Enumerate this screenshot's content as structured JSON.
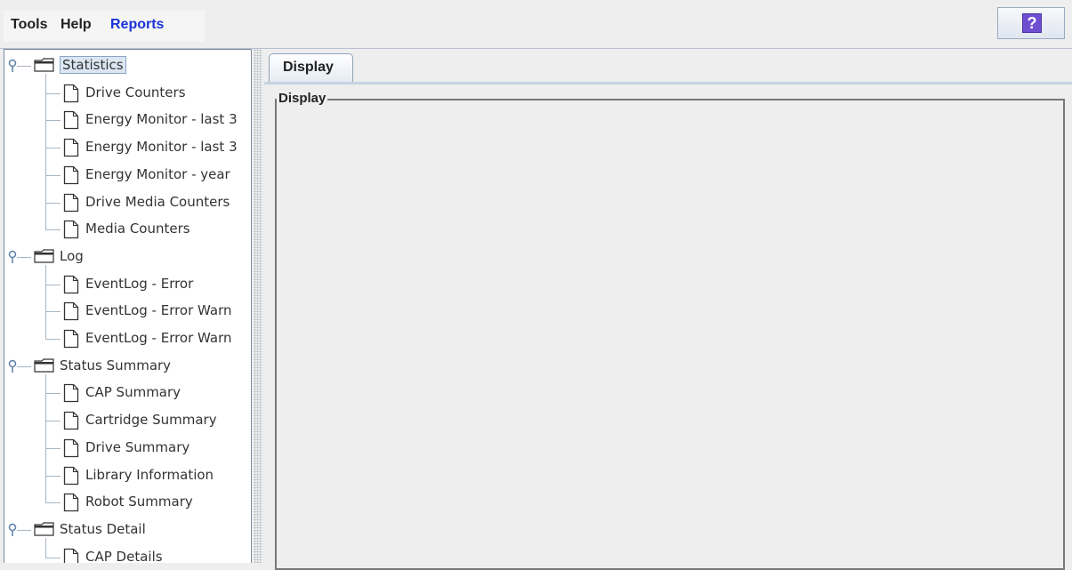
{
  "menubar": {
    "menus": [
      "Tools",
      "Help",
      "Reports"
    ],
    "help_button_label": "?"
  },
  "tree": [
    {
      "label": "Statistics",
      "selected": true,
      "children": [
        "Drive Counters",
        "Energy Monitor - last 3",
        "Energy Monitor - last 3",
        "Energy Monitor - year",
        "Drive Media Counters",
        "Media Counters"
      ]
    },
    {
      "label": "Log",
      "children": [
        "EventLog - Error",
        "EventLog - Error Warn",
        "EventLog - Error Warn"
      ]
    },
    {
      "label": "Status Summary",
      "children": [
        "CAP Summary",
        "Cartridge Summary",
        "Drive Summary",
        "Library Information",
        "Robot Summary"
      ]
    },
    {
      "label": "Status Detail",
      "children": [
        "CAP Details"
      ]
    }
  ],
  "tabs": [
    {
      "label": "Display"
    }
  ],
  "display_group": {
    "title": "Display"
  },
  "colors": {
    "accent": "#1a33d6",
    "help_icon": "#6f4fd1",
    "selection": "#dce6f2"
  }
}
